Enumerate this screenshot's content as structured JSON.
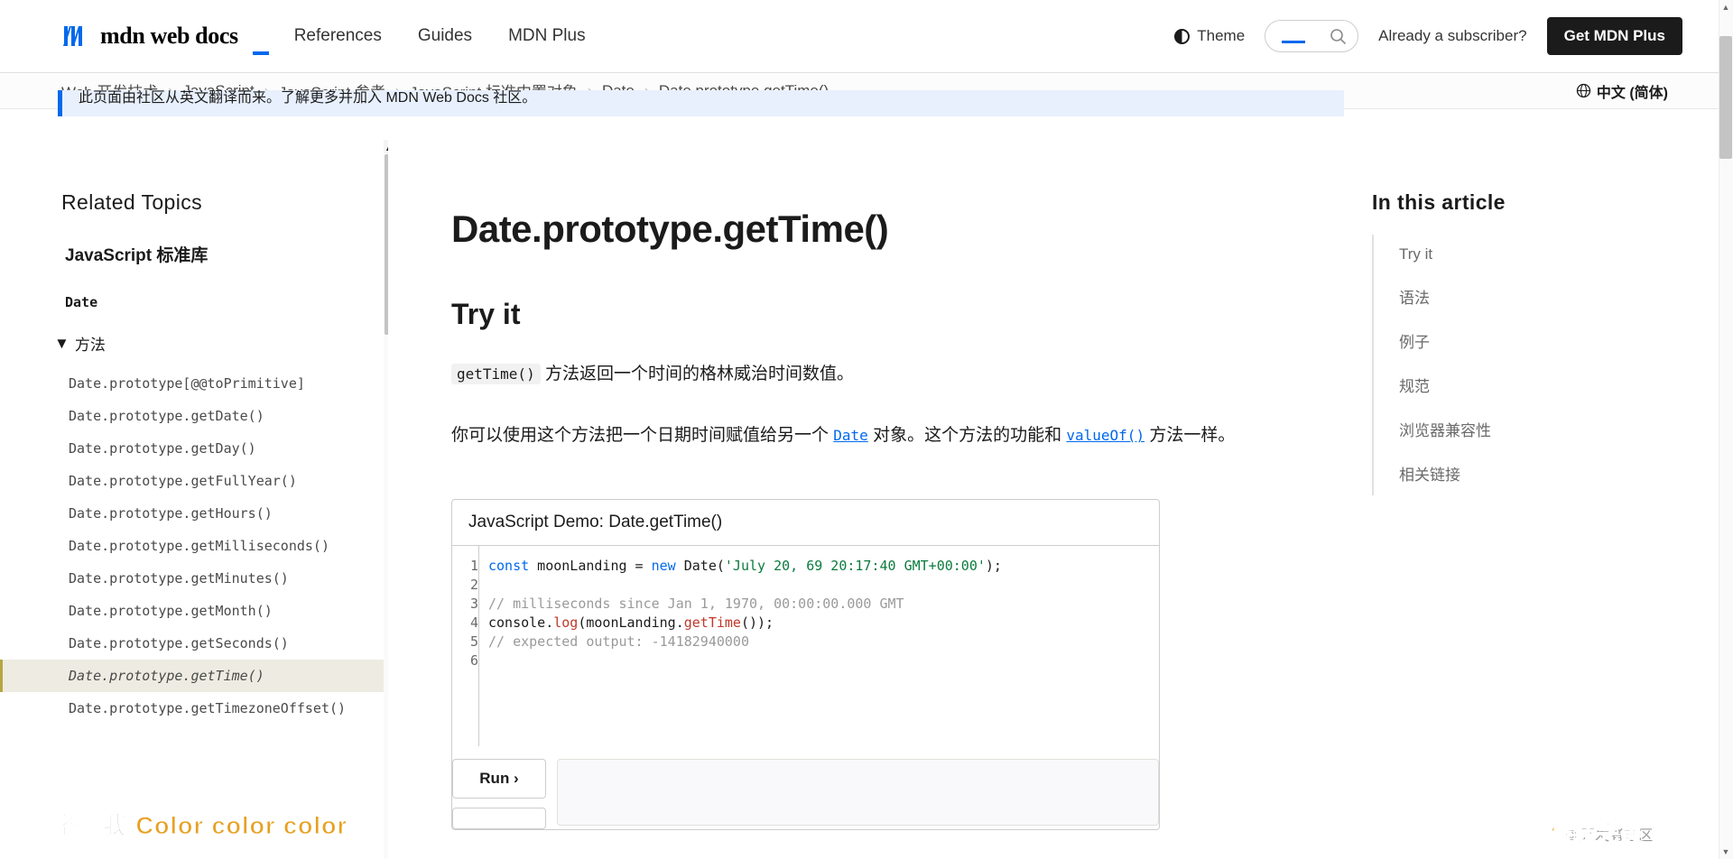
{
  "header": {
    "logo_text": "mdn web docs",
    "nav": [
      {
        "label": "References"
      },
      {
        "label": "Guides"
      },
      {
        "label": "MDN Plus"
      }
    ],
    "theme_label": "Theme",
    "search_placeholder": "",
    "search_value": "",
    "subscriber_label": "Already a subscriber?",
    "plus_button": "Get MDN Plus"
  },
  "breadcrumb": {
    "items": [
      {
        "label": "Web 开发技术"
      },
      {
        "label": "JavaScript"
      },
      {
        "label": "JavaScript 参考"
      },
      {
        "label": "JavaScript 标准内置对象"
      },
      {
        "label": "Date"
      },
      {
        "label": "Date.prototype.getTime()"
      }
    ],
    "separator": "›",
    "language": "中文 (简体)"
  },
  "banner": {
    "text": "此页面由社区从英文翻译而来。了解更多并加入 MDN Web Docs 社区。"
  },
  "sidebar": {
    "title": "Related Topics",
    "subtitle": "JavaScript 标准库",
    "group": "Date",
    "toggle_label": "方法",
    "toggle_icon": "▼",
    "items": [
      {
        "label": "Date.prototype[@@toPrimitive]",
        "active": false
      },
      {
        "label": "Date.prototype.getDate()",
        "active": false
      },
      {
        "label": "Date.prototype.getDay()",
        "active": false
      },
      {
        "label": "Date.prototype.getFullYear()",
        "active": false
      },
      {
        "label": "Date.prototype.getHours()",
        "active": false
      },
      {
        "label": "Date.prototype.getMilliseconds()",
        "active": false
      },
      {
        "label": "Date.prototype.getMinutes()",
        "active": false
      },
      {
        "label": "Date.prototype.getMonth()",
        "active": false
      },
      {
        "label": "Date.prototype.getSeconds()",
        "active": false
      },
      {
        "label": "Date.prototype.getTime()",
        "active": true
      },
      {
        "label": "Date.prototype.getTimezoneOffset()",
        "active": false
      }
    ]
  },
  "article": {
    "h1": "Date.prototype.getTime()",
    "h2_try_it": "Try it",
    "p1_code": "getTime()",
    "p1_rest": " 方法返回一个时间的格林威治时间数值。",
    "p2_a": "你可以使用这个方法把一个日期时间赋值给另一个 ",
    "p2_link1": "Date",
    "p2_b": " 对象。这个方法的功能和 ",
    "p2_link2": "valueOf()",
    "p2_c": " 方法一样。",
    "demo": {
      "title": "JavaScript Demo: Date.getTime()",
      "line_numbers": [
        "1",
        "2",
        "3",
        "4",
        "5",
        "6"
      ],
      "code": {
        "l1_kw1": "const",
        "l1_var": " moonLanding = ",
        "l1_kw2": "new",
        "l1_ctor": " Date(",
        "l1_str": "'July 20, 69 20:17:40 GMT+00:00'",
        "l1_end": ");",
        "l3_comment": "// milliseconds since Jan 1, 1970, 00:00:00.000 GMT",
        "l4_a": "console.",
        "l4_log": "log",
        "l4_b": "(moonLanding.",
        "l4_fn": "getTime",
        "l4_c": "());",
        "l5_comment": "// expected output: -14182940000"
      },
      "run_button": "Run ›",
      "reset_button": ""
    }
  },
  "toc": {
    "title": "In this article",
    "items": [
      {
        "label": "Try it"
      },
      {
        "label": "语法"
      },
      {
        "label": "例子"
      },
      {
        "label": "规范"
      },
      {
        "label": "浏览器兼容性"
      },
      {
        "label": "相关链接"
      }
    ]
  },
  "watermarks": {
    "left_cjk": "坚持我",
    "left_latin": "Color color color",
    "right_cjk": "假装完美",
    "copyright": "© 开发者社区"
  },
  "colors": {
    "accent": "#0069ed",
    "banner_bg": "#e8f0fe",
    "active_item_bg": "#eeece2",
    "plus_button_bg": "#1b1b1b"
  }
}
